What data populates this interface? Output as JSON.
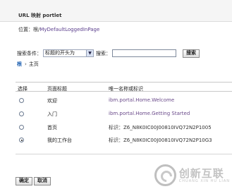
{
  "portlet": {
    "title": "URL 映射 portlet"
  },
  "location": {
    "label": "位置：根/",
    "link": "MyDefaultLoggedInPage"
  },
  "search": {
    "criteria_label": "搜索条件：",
    "criteria_value": "标题的开头为",
    "search_label": "搜索：",
    "search_value": "",
    "button_label": "搜索"
  },
  "breadcrumb": {
    "root": "根",
    "separator": "›",
    "current": "主页"
  },
  "table": {
    "headers": [
      "选择",
      "页面标题",
      "唯一名称或标识"
    ],
    "rows": [
      {
        "title": "欢迎",
        "uid": "ibm.portal.Home.Welcome",
        "selected": false
      },
      {
        "title": "入门",
        "uid": "ibm.portal.Home.Getting Started",
        "selected": false
      },
      {
        "title": "首页",
        "uid": "标识：Z6_N8K0IC00J00810IVQ72N2P1005",
        "selected": false
      },
      {
        "title": "我的工作台",
        "uid": "标识：Z6_N8K0IC00J00810IVQ72N2P10G3",
        "selected": true
      }
    ]
  },
  "actions": {
    "ok": "确定",
    "cancel": "取消"
  },
  "watermark": {
    "cn": "创新互联",
    "en": "CHUANG XIN HU LIAN"
  }
}
